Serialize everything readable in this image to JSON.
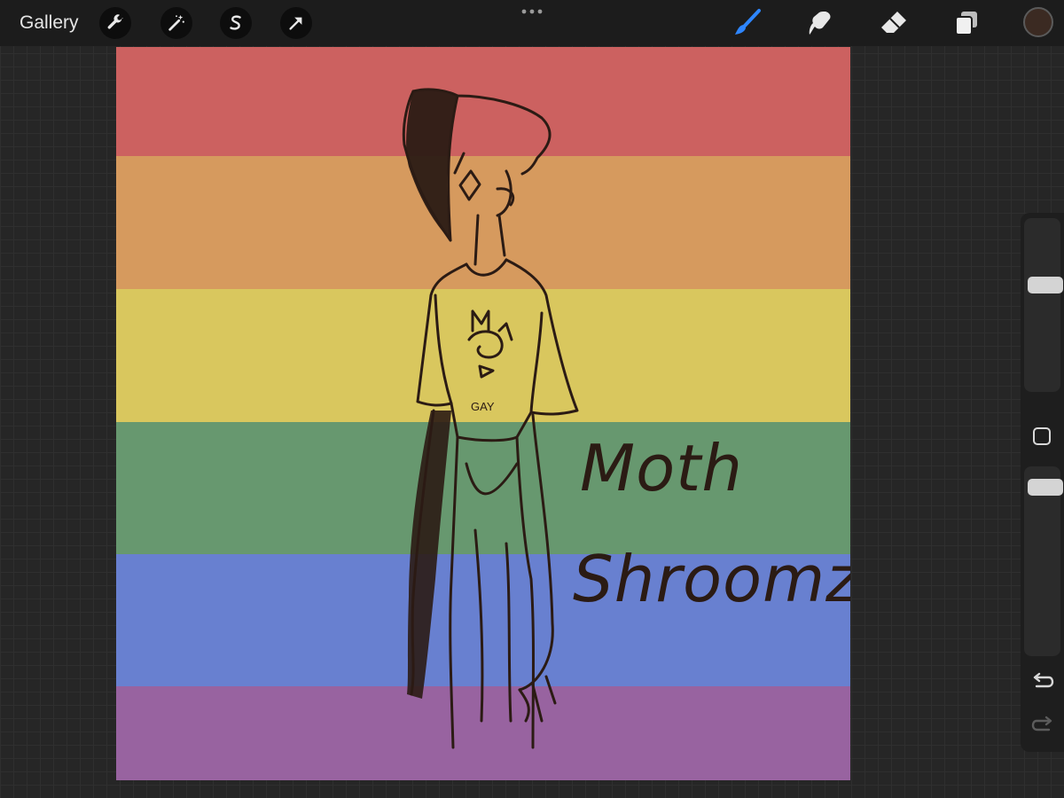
{
  "topbar": {
    "gallery_label": "Gallery",
    "left_tools": [
      "wrench-icon",
      "magic-wand-icon",
      "selection-icon",
      "transform-arrow-icon"
    ],
    "right_tools": [
      "brush-icon",
      "smudge-icon",
      "eraser-icon",
      "layers-icon"
    ],
    "active_tool": "brush",
    "current_color": "#3b2a22",
    "accent_color": "#2e86ff"
  },
  "canvas": {
    "stripe_colors": [
      "#cc6160",
      "#d69a5e",
      "#d9c75e",
      "#67986f",
      "#6880d0",
      "#9863a0"
    ],
    "line_color": "#2b1b14",
    "title_line1": "Moth",
    "title_line2": "Shroomz",
    "shirt_text": "GAY"
  },
  "sidebar": {
    "brush_size_label": "brush-size-slider",
    "opacity_label": "opacity-slider",
    "undo_icon": "undo-icon",
    "redo_icon": "redo-icon",
    "modify_icon": "square-modify-icon"
  }
}
